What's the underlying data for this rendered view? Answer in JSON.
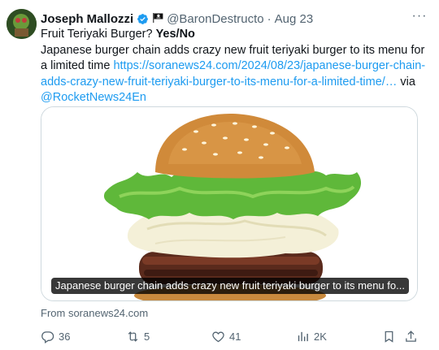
{
  "tweet": {
    "display_name": "Joseph Mallozzi",
    "handle": "@BaronDestructo",
    "separator": "·",
    "date": "Aug 23",
    "more_label": "···",
    "text_line1_plain": "Fruit Teriyaki Burger? ",
    "text_line1_bold": "Yes/No",
    "text_body": "Japanese burger chain adds crazy new fruit teriyaki burger to its menu for a limited time ",
    "link": "https://soranews24.com/2024/08/23/japanese-burger-chain-adds-crazy-new-fruit-teriyaki-burger-to-its-menu-for-a-limited-time/…",
    "via_text": " via ",
    "mention": "@RocketNews24En"
  },
  "media": {
    "caption": "Japanese burger chain adds crazy new fruit teriyaki burger to its menu fo..."
  },
  "source_line": "From soranews24.com",
  "actions": {
    "replies": "36",
    "reposts": "5",
    "likes": "41",
    "views": "2K"
  },
  "colors": {
    "link": "#1d9bf0",
    "muted": "#536471",
    "verified": "#1d9bf0"
  }
}
